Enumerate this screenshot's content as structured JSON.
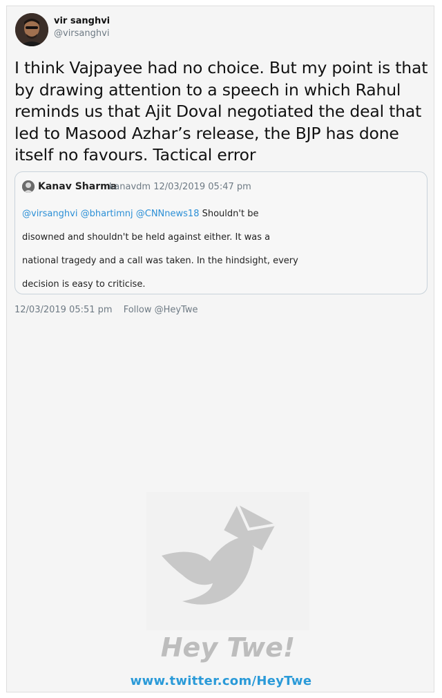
{
  "tweet": {
    "author_name": "vir sanghvi",
    "author_handle": "@virsanghvi",
    "text": "I think Vajpayee had no choice. But my point is that by drawing attention to a speech in which Rahul reminds us that Ajit Doval negotiated the deal that led to Masood Azhar’s release, the BJP has done itself no favours. Tactical error",
    "timestamp": "12/03/2019 05:51 pm",
    "follow_label": "Follow @HeyTwe"
  },
  "quoted": {
    "author_name": "Kanav Sharma",
    "meta": "kanavdm 12/03/2019 05:47 pm",
    "mentions": [
      "@virsanghvi",
      "@bhartimnj",
      "@CNNnews18"
    ],
    "line1_rest": "Shouldn't be",
    "line2": "disowned and shouldn't be held against either. It was a",
    "line3": "national tragedy and a call was taken. In the hindsight, every",
    "line4": "decision is easy to criticise."
  },
  "watermark": {
    "brand": "Hey Twe!",
    "url": "www.twitter.com/HeyTwe"
  },
  "colors": {
    "link": "#2b8fd6",
    "muted": "#6e7a84",
    "watermark_gray": "#c8c8c8",
    "watermark_url": "#2a9ad8"
  }
}
